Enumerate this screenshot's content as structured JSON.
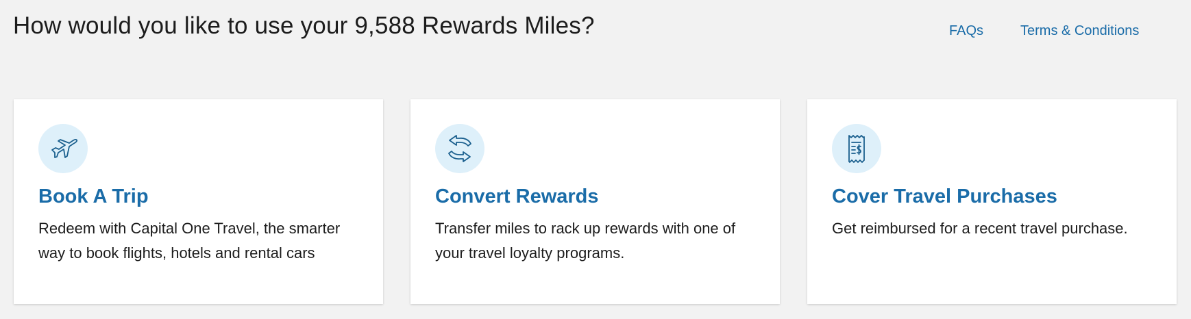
{
  "header": {
    "title": "How would you like to use your 9,588 Rewards Miles?",
    "links": [
      {
        "label": "FAQs"
      },
      {
        "label": "Terms & Conditions"
      }
    ]
  },
  "cards": [
    {
      "icon": "airplane-icon",
      "title": "Book A Trip",
      "description": "Redeem with Capital One Travel, the smarter way to book flights, hotels and rental cars"
    },
    {
      "icon": "transfer-arrows-icon",
      "title": "Convert Rewards",
      "description": "Transfer miles to rack up rewards with one of your travel loyalty programs."
    },
    {
      "icon": "receipt-icon",
      "title": "Cover Travel Purchases",
      "description": "Get reimbursed for a recent travel purchase."
    }
  ],
  "colors": {
    "accent": "#1a6ca8",
    "icon_bg": "#def0fa",
    "page_bg": "#f2f2f2",
    "card_bg": "#ffffff"
  }
}
